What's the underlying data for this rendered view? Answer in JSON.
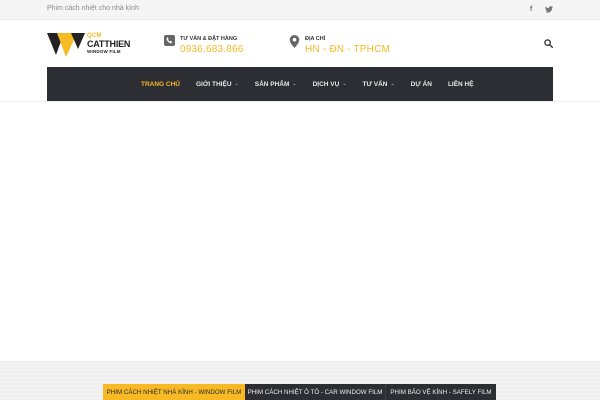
{
  "topbar": {
    "tagline": "Phim cách nhiệt cho nhà kính",
    "social": [
      {
        "icon": "facebook-icon",
        "glyph": "f"
      },
      {
        "icon": "twitter-icon",
        "glyph": "🐦"
      }
    ]
  },
  "logo": {
    "top": "QCM",
    "name": "CATTHIEN",
    "sub": "WINDOW FILM"
  },
  "contact": {
    "phone_label": "TƯ VẤN & ĐẶT HÀNG",
    "phone_value": "0936.683.866",
    "address_label": "ĐỊA CHỈ",
    "address_value": "HN - ĐN - TPHCM"
  },
  "nav": {
    "items": [
      {
        "label": "TRANG CHỦ"
      },
      {
        "label": "GIỚI THIỆU"
      },
      {
        "label": "SẢN PHẨM"
      },
      {
        "label": "DỊCH VỤ"
      },
      {
        "label": "TƯ VẤN"
      },
      {
        "label": "DỰ ÁN"
      },
      {
        "label": "LIÊN HỆ"
      }
    ]
  },
  "tabs": [
    {
      "label": "PHIM CÁCH NHIỆT NHÀ KÍNH - WINDOW FILM"
    },
    {
      "label": "PHIM CÁCH NHIỆT Ô TÔ - CAR WINDOW FILM"
    },
    {
      "label": "PHIM BẢO VỆ KÍNH - SAFELY FILM"
    }
  ],
  "colors": {
    "accent": "#f7b924",
    "nav_bg": "#2c2e33",
    "topbar_bg": "#f5f5f5"
  }
}
